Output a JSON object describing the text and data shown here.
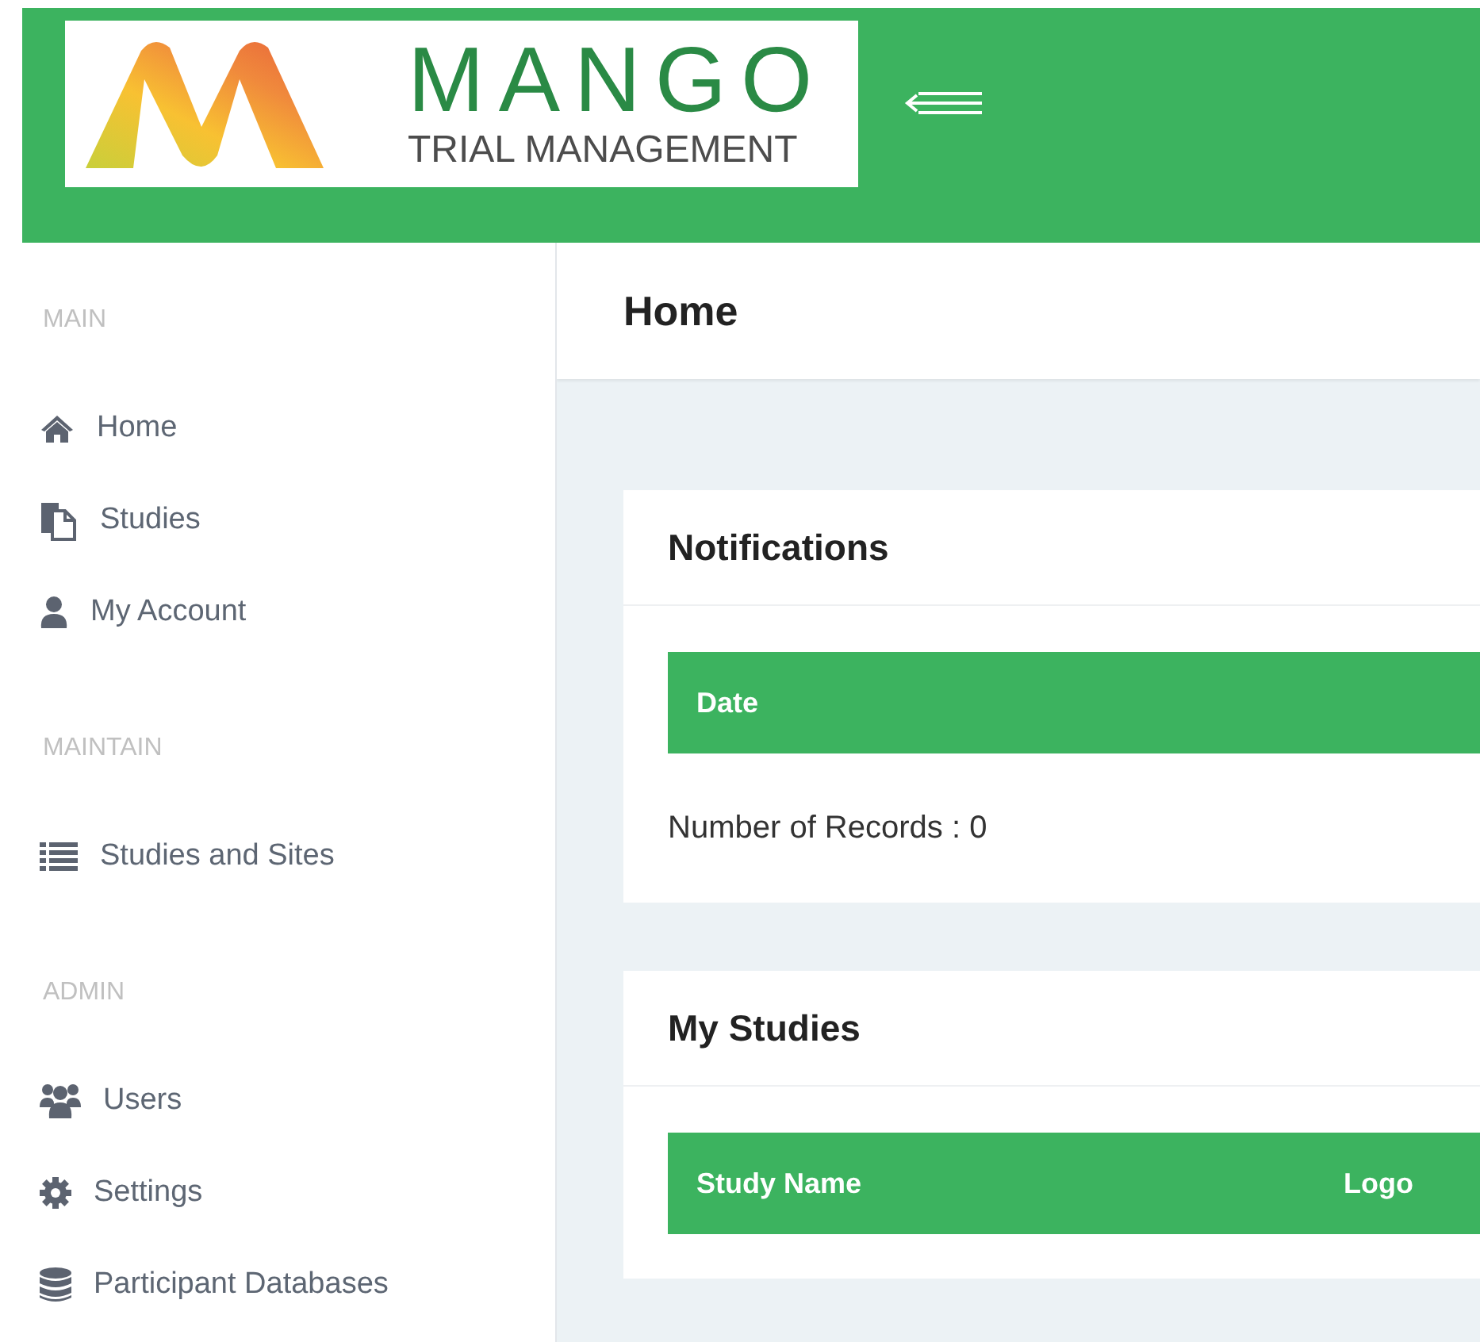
{
  "logo": {
    "title": "MANGO",
    "subtitle": "TRIAL MANAGEMENT"
  },
  "sidebar": {
    "sections": [
      {
        "heading": "MAIN",
        "items": [
          {
            "label": "Home",
            "kind": "home"
          },
          {
            "label": "Studies",
            "kind": "files"
          },
          {
            "label": "My Account",
            "kind": "user"
          }
        ]
      },
      {
        "heading": "MAINTAIN",
        "items": [
          {
            "label": "Studies and Sites",
            "kind": "list"
          }
        ]
      },
      {
        "heading": "ADMIN",
        "items": [
          {
            "label": "Users",
            "kind": "users"
          },
          {
            "label": "Settings",
            "kind": "gear"
          },
          {
            "label": "Participant Databases",
            "kind": "database"
          }
        ]
      }
    ]
  },
  "page": {
    "title": "Home"
  },
  "cards": [
    {
      "title": "Notifications",
      "columns": [
        "Date"
      ],
      "footer": "Number of Records : 0"
    },
    {
      "title": "My Studies",
      "columns": [
        "Study Name",
        "Logo"
      ]
    }
  ]
}
